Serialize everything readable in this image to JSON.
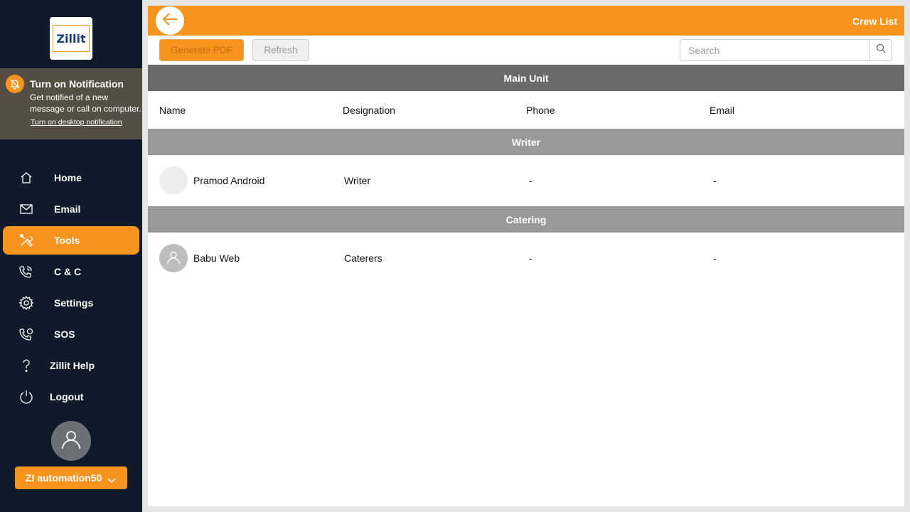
{
  "sidebar": {
    "logo_text": "Zillit",
    "notification": {
      "title": "Turn on Notification",
      "text": "Get notified of a new message or call on computer.",
      "link": "Turn on desktop notification"
    },
    "items": [
      {
        "label": "Home",
        "icon": "home-icon"
      },
      {
        "label": "Email",
        "icon": "mail-icon"
      },
      {
        "label": "Tools",
        "icon": "tools-icon",
        "active": true
      },
      {
        "label": "C & C",
        "icon": "phone-icon"
      },
      {
        "label": "Settings",
        "icon": "gear-icon"
      },
      {
        "label": "SOS",
        "icon": "sos-icon"
      },
      {
        "label": "Zillit Help",
        "icon": "question-icon"
      },
      {
        "label": "Logout",
        "icon": "power-icon"
      }
    ],
    "user_name": "ZI automation50"
  },
  "header": {
    "title": "Crew List"
  },
  "toolbar": {
    "generate_pdf_label": "Generate PDF",
    "refresh_label": "Refresh",
    "search_placeholder": "Search"
  },
  "table": {
    "unit": "Main Unit",
    "columns": [
      "Name",
      "Designation",
      "Phone",
      "Email"
    ],
    "groups": [
      {
        "name": "Writer",
        "rows": [
          {
            "name": "Pramod Android",
            "designation": "Writer",
            "phone": "-",
            "email": "-"
          }
        ]
      },
      {
        "name": "Catering",
        "rows": [
          {
            "name": "Babu Web",
            "designation": "Caterers",
            "phone": "-",
            "email": "-"
          }
        ]
      }
    ]
  },
  "colors": {
    "accent": "#f7941d",
    "sidebar_bg": "#0f1a2b",
    "notification_bg": "#574e43"
  }
}
